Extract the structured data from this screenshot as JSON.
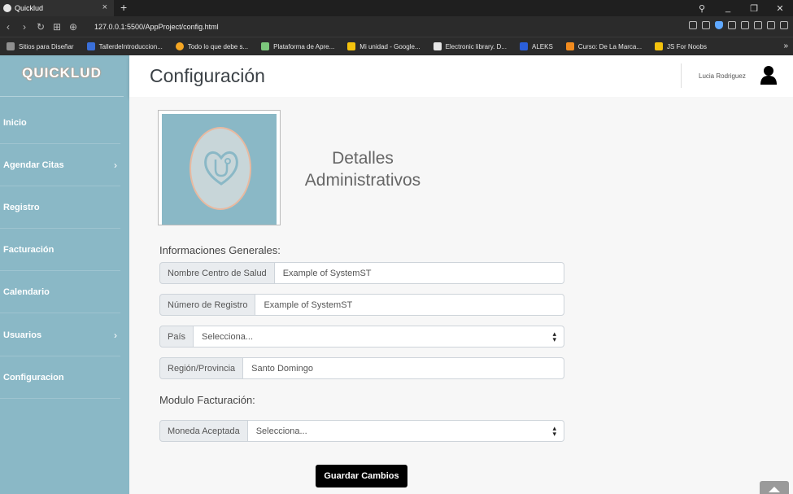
{
  "browser": {
    "tab_title": "Quicklud",
    "tab_close": "×",
    "new_tab": "+",
    "url": "127.0.0.1:5500/AppProject/config.html",
    "window_controls": [
      "⚲",
      "_",
      "❐",
      "✕"
    ],
    "bookmarks": [
      {
        "label": "Sitios para Diseñar",
        "icon": "folder-icon",
        "color": "#8f8f8f"
      },
      {
        "label": "TallerdeIntroduccion...",
        "icon": "bookmark-icon",
        "color": "#3a6fd8"
      },
      {
        "label": "Todo lo que debe s...",
        "icon": "bookmark-icon",
        "color": "#f5a623"
      },
      {
        "label": "Plataforma de Apre...",
        "icon": "bookmark-icon",
        "color": "#7bc67b"
      },
      {
        "label": "Mi unidad - Google...",
        "icon": "drive-icon",
        "color": "#f4c20d"
      },
      {
        "label": "Electronic library. D...",
        "icon": "bookmark-icon",
        "color": "#e6e6e6"
      },
      {
        "label": "ALEKS",
        "icon": "bookmark-icon",
        "color": "#2b5fd9"
      },
      {
        "label": "Curso: De La Marca...",
        "icon": "bookmark-icon",
        "color": "#f28b1e"
      },
      {
        "label": "JS For Noobs",
        "icon": "bookmark-icon",
        "color": "#f4c20d"
      }
    ],
    "bookmarks_more": "»"
  },
  "sidebar": {
    "brand": "QUICKLUD",
    "items": [
      {
        "label": "Inicio",
        "has_submenu": false,
        "chevron": ""
      },
      {
        "label": "Agendar Citas",
        "has_submenu": true,
        "chevron": "›"
      },
      {
        "label": "Registro",
        "has_submenu": false,
        "chevron": ""
      },
      {
        "label": "Facturación",
        "has_submenu": false,
        "chevron": ""
      },
      {
        "label": "Calendario",
        "has_submenu": false,
        "chevron": ""
      },
      {
        "label": "Usuarios",
        "has_submenu": true,
        "chevron": "›"
      },
      {
        "label": "Configuracion",
        "has_submenu": false,
        "chevron": ""
      }
    ]
  },
  "header": {
    "title": "Configuración",
    "user_name": "Lucia Rodriguez"
  },
  "main": {
    "section_title": "Detalles Administrativos",
    "general_label": "Informaciones Generales:",
    "fields": {
      "health_center": {
        "label": "Nombre Centro de Salud",
        "value": "Example of SystemST"
      },
      "registry_number": {
        "label": "Número de Registro",
        "value": "Example of SystemST"
      },
      "country": {
        "label": "País",
        "value": "Selecciona..."
      },
      "region": {
        "label": "Región/Provincia",
        "value": "Santo Domingo"
      }
    },
    "billing_label": "Modulo Facturación:",
    "currency": {
      "label": "Moneda Aceptada",
      "value": "Selecciona..."
    },
    "save_label": "Guardar Cambios"
  },
  "colors": {
    "sidebar": "#8ab8c6",
    "logo_accent": "#e8b9a0",
    "button": "#000000"
  }
}
